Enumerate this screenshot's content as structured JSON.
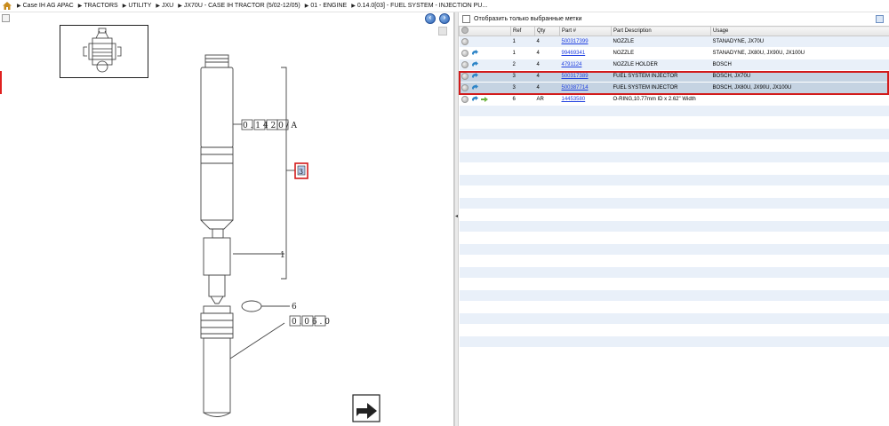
{
  "breadcrumb": {
    "items": [
      "Case IH AG APAC",
      "TRACTORS",
      "UTILITY",
      "JXU",
      "JX70U - CASE IH TRACTOR (5/02-12/05)",
      "01 - ENGINE",
      "0.14.0[03] - FUEL SYSTEM - INJECTION PU..."
    ]
  },
  "nav": {
    "back": "‹",
    "forward": "›"
  },
  "diagram": {
    "callout_top": "0 . 1 4 2 0 / A",
    "ref_highlight": "3",
    "ref_1": "1",
    "ref_6": "6",
    "callout_bottom": "0 . 0 6 . 0"
  },
  "filter": {
    "label": "Отобразить только выбранные метки"
  },
  "table": {
    "headers": [
      "",
      "Ref",
      "Qty",
      "Part #",
      "Part Description",
      "Usage"
    ],
    "rows": [
      {
        "ref": "1",
        "qty": "4",
        "part": "500317399",
        "desc": "NOZZLE",
        "usage": "STANADYNE, JX70U",
        "link": false,
        "replace": false,
        "selected": false
      },
      {
        "ref": "1",
        "qty": "4",
        "part": "99469341",
        "desc": "NOZZLE",
        "usage": "STANADYNE, JX80U, JX90U, JX100U",
        "link": true,
        "replace": false,
        "selected": false
      },
      {
        "ref": "2",
        "qty": "4",
        "part": "4791124",
        "desc": "NOZZLE HOLDER",
        "usage": "BOSCH",
        "link": true,
        "replace": false,
        "selected": false
      },
      {
        "ref": "3",
        "qty": "4",
        "part": "500317389",
        "desc": "FUEL SYSTEM INJECTOR",
        "usage": "BOSCH, JX70U",
        "link": true,
        "replace": false,
        "selected": true
      },
      {
        "ref": "3",
        "qty": "4",
        "part": "500387714",
        "desc": "FUEL SYSTEM INJECTOR",
        "usage": "BOSCH, JX80U, JX90U, JX100U",
        "link": true,
        "replace": false,
        "selected": true
      },
      {
        "ref": "6",
        "qty": "AR",
        "part": "14453580",
        "desc": "O-RING,10.77mm ID x 2.62\" Width",
        "usage": "",
        "link": true,
        "replace": true,
        "selected": false
      }
    ]
  },
  "colors": {
    "accent": "#d21b1b",
    "link": "#1f3fe0",
    "row_alt": "#e9f0f9",
    "row_selected": "#c5d3e2"
  }
}
